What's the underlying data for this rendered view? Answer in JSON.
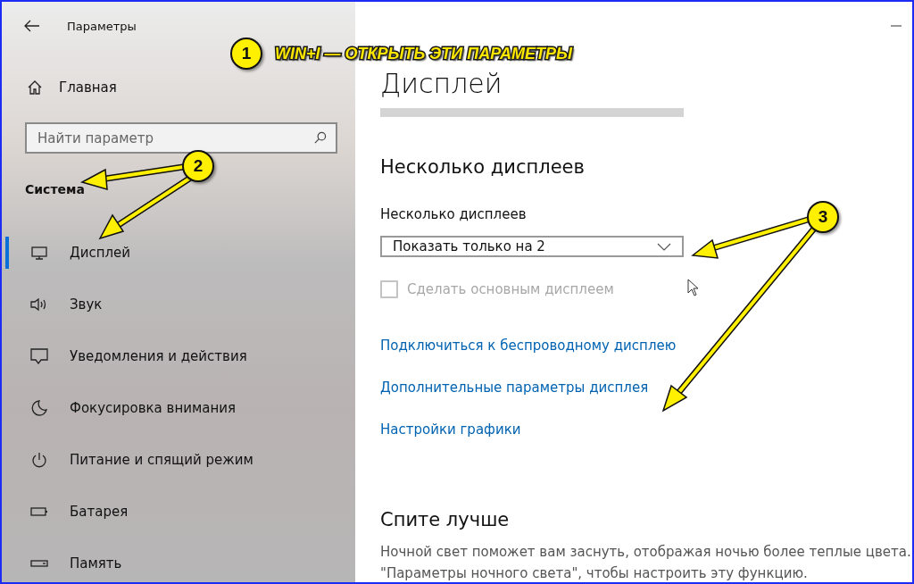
{
  "window": {
    "title": "Параметры"
  },
  "sidebar": {
    "home": "Главная",
    "search": {
      "placeholder": "Найти параметр"
    },
    "section": "Система",
    "items": [
      {
        "label": "Дисплей",
        "selected": true
      },
      {
        "label": "Звук",
        "selected": false
      },
      {
        "label": "Уведомления и действия",
        "selected": false
      },
      {
        "label": "Фокусировка внимания",
        "selected": false
      },
      {
        "label": "Питание и спящий режим",
        "selected": false
      },
      {
        "label": "Батарея",
        "selected": false
      },
      {
        "label": "Память",
        "selected": false
      }
    ]
  },
  "page": {
    "title": "Дисплей",
    "multi": {
      "heading": "Несколько дисплеев",
      "label": "Несколько дисплеев",
      "value": "Показать только на 2",
      "checkbox": {
        "label": "Сделать основным дисплеем",
        "checked": false,
        "disabled": true
      }
    },
    "links": [
      "Подключиться к беспроводному дисплею",
      "Дополнительные параметры дисплея",
      "Настройки графики"
    ],
    "sleep": {
      "heading": "Спите лучше",
      "lines": [
        "Ночной свет поможет вам заснуть, отображая ночью более теплые цвета.",
        "\"Параметры ночного света\", чтобы настроить эту функцию."
      ]
    }
  },
  "annotations": [
    {
      "number": "1",
      "text": "WIN+I — ОТКРЫТЬ ЭТИ ПАРАМЕТРЫ"
    },
    {
      "number": "2"
    },
    {
      "number": "3"
    }
  ]
}
